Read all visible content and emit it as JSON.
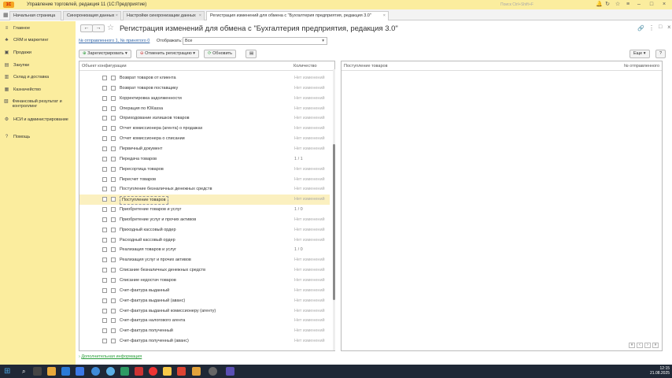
{
  "app": {
    "title": "Управление торговлей, редакция 11  (1С:Предприятие)",
    "search_placeholder": "Поиск Ctrl+Shift+F"
  },
  "tabs": [
    {
      "label": "Начальная страница"
    },
    {
      "label": "Синхронизация данных"
    },
    {
      "label": "Настройки синхронизации данных"
    },
    {
      "label": "Регистрация изменений для обмена с \"Бухгалтерия предприятия, редакция 3.0\""
    }
  ],
  "sidebar": {
    "items": [
      {
        "icon": "menu-icon",
        "label": "Главное"
      },
      {
        "icon": "crm-icon",
        "label": "CRM и маркетинг"
      },
      {
        "icon": "sales-icon",
        "label": "Продажи"
      },
      {
        "icon": "purchases-icon",
        "label": "Закупки"
      },
      {
        "icon": "warehouse-icon",
        "label": "Склад и доставка"
      },
      {
        "icon": "treasury-icon",
        "label": "Казначейство"
      },
      {
        "icon": "finance-icon",
        "label": "Финансовый результат и контроллинг"
      },
      {
        "icon": "settings-icon",
        "label": "НСИ и администрирование"
      },
      {
        "icon": "help-icon",
        "label": "Помощь"
      }
    ]
  },
  "doc": {
    "title": "Регистрация изменений для обмена с  \"Бухгалтерия предприятия, редакция 3.0\"",
    "msg_link": "№ отправленного 1, № принятого 0",
    "show_label": "Отображать:",
    "show_value": "Все",
    "register_btn": "Зарегистрировать",
    "cancel_btn": "Отменить регистрацию",
    "refresh_btn": "Обновить",
    "more_btn": "Еще",
    "help_btn": "?"
  },
  "left_table": {
    "col_object": "Объект конфигурации",
    "col_count": "Количество",
    "rows": [
      {
        "name": "Возврат товаров от клиента",
        "count": "Нет изменений"
      },
      {
        "name": "Возврат товаров поставщику",
        "count": "Нет изменений"
      },
      {
        "name": "Корректировка задолженности",
        "count": "Нет изменений"
      },
      {
        "name": "Операция по ЮКassa",
        "count": "Нет изменений"
      },
      {
        "name": "Оприходование излишков товаров",
        "count": "Нет изменений"
      },
      {
        "name": "Отчет комиссионера (агента) о продажах",
        "count": "Нет изменений"
      },
      {
        "name": "Отчет комиссионера о списании",
        "count": "Нет изменений"
      },
      {
        "name": "Первичный документ",
        "count": "Нет изменений"
      },
      {
        "name": "Передача товаров",
        "count": "1 / 1"
      },
      {
        "name": "Пересортица товаров",
        "count": "Нет изменений"
      },
      {
        "name": "Пересчет товаров",
        "count": "Нет изменений"
      },
      {
        "name": "Поступление безналичных денежных средств",
        "count": "Нет изменений"
      },
      {
        "name": "Поступление товаров",
        "count": "Нет изменений"
      },
      {
        "name": "Приобретение товаров и услуг",
        "count": "1 / 0"
      },
      {
        "name": "Приобретение услуг и прочих активов",
        "count": "Нет изменений"
      },
      {
        "name": "Приходный кассовый ордер",
        "count": "Нет изменений"
      },
      {
        "name": "Расходный кассовый ордер",
        "count": "Нет изменений"
      },
      {
        "name": "Реализация товаров и услуг",
        "count": "1 / 0"
      },
      {
        "name": "Реализация услуг и прочих активов",
        "count": "Нет изменений"
      },
      {
        "name": "Списание безналичных денежных средств",
        "count": "Нет изменений"
      },
      {
        "name": "Списание недостач товаров",
        "count": "Нет изменений"
      },
      {
        "name": "Счет-фактура выданный",
        "count": "Нет изменений"
      },
      {
        "name": "Счет-фактура выданный (аванс)",
        "count": "Нет изменений"
      },
      {
        "name": "Счет-фактура выданный комиссионеру (агенту)",
        "count": "Нет изменений"
      },
      {
        "name": "Счет-фактура налогового агента",
        "count": "Нет изменений"
      },
      {
        "name": "Счет-фактура полученный",
        "count": "Нет изменений"
      },
      {
        "name": "Счет-фактура полученный (аванс)",
        "count": "Нет изменений"
      }
    ]
  },
  "right_table": {
    "col_left": "Поступление товаров",
    "col_right": "№ отправленного"
  },
  "footer": {
    "more_info": "Дополнительная информация"
  },
  "clock": {
    "time": "12:15",
    "date": "21.08.2025"
  }
}
